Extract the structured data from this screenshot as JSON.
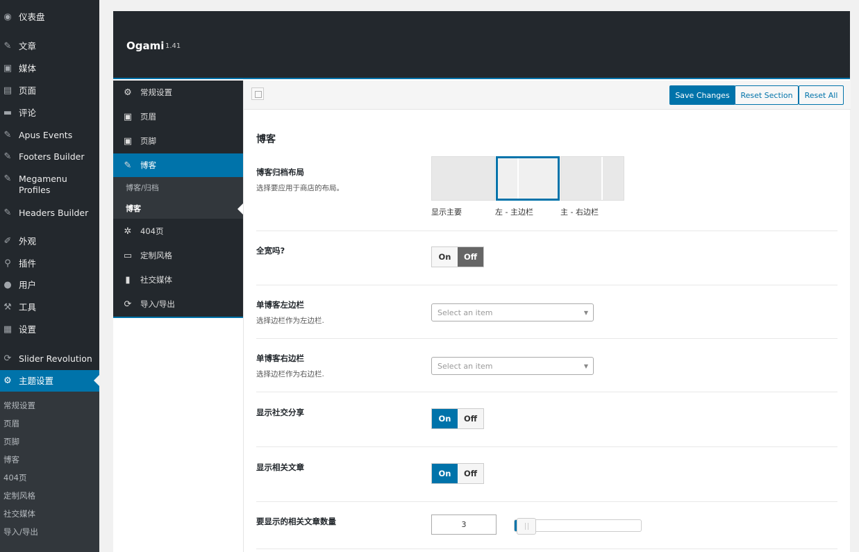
{
  "wp_sidebar": {
    "items": [
      {
        "label": "仪表盘",
        "icon": "dashboard-icon"
      },
      {
        "label": "文章",
        "icon": "pin-icon"
      },
      {
        "label": "媒体",
        "icon": "media-icon"
      },
      {
        "label": "页面",
        "icon": "page-icon"
      },
      {
        "label": "评论",
        "icon": "comment-icon"
      },
      {
        "label": "Apus Events",
        "icon": "pin-icon"
      },
      {
        "label": "Footers Builder",
        "icon": "pin-icon"
      },
      {
        "label": "Megamenu Profiles",
        "icon": "pin-icon"
      },
      {
        "label": "Headers Builder",
        "icon": "pin-icon"
      },
      {
        "label": "外观",
        "icon": "brush-icon"
      },
      {
        "label": "插件",
        "icon": "plugin-icon"
      },
      {
        "label": "用户",
        "icon": "user-icon"
      },
      {
        "label": "工具",
        "icon": "wrench-icon"
      },
      {
        "label": "设置",
        "icon": "settings-icon"
      },
      {
        "label": "Slider Revolution",
        "icon": "slider-icon"
      },
      {
        "label": "主题设置",
        "icon": "gear-icon"
      }
    ],
    "submenu": [
      "常规设置",
      "页眉",
      "页脚",
      "博客",
      "404页",
      "定制风格",
      "社交媒体",
      "导入/导出"
    ]
  },
  "panel": {
    "title": "Ogami",
    "version": "1.41"
  },
  "ogami_nav": {
    "items": [
      {
        "label": "常规设置",
        "icon": "cogs-icon"
      },
      {
        "label": "页眉",
        "icon": "window-icon"
      },
      {
        "label": "页脚",
        "icon": "window-icon"
      },
      {
        "label": "博客",
        "icon": "pencil-icon"
      },
      {
        "label": "404页",
        "icon": "gear-icon"
      },
      {
        "label": "定制风格",
        "icon": "css-icon"
      },
      {
        "label": "社交媒体",
        "icon": "phone-icon"
      },
      {
        "label": "导入/导出",
        "icon": "refresh-icon"
      }
    ],
    "subitems": [
      "博客/归档",
      "博客"
    ]
  },
  "toolbar": {
    "save": "Save Changes",
    "reset_section": "Reset Section",
    "reset_all": "Reset All"
  },
  "section": {
    "title": "博客"
  },
  "fields": {
    "archive_layout": {
      "label": "博客归档布局",
      "desc": "选择要应用于商店的布局。",
      "options": [
        "显示主要",
        "左 - 主边栏",
        "主 - 右边栏"
      ],
      "selected_index": 1
    },
    "full_width": {
      "label": "全宽吗?",
      "on": "On",
      "off": "Off",
      "state": "off"
    },
    "left_sidebar": {
      "label": "单博客左边栏",
      "desc": "选择边栏作为左边栏.",
      "placeholder": "Select an item"
    },
    "right_sidebar": {
      "label": "单博客右边栏",
      "desc": "选择边栏作为右边栏.",
      "placeholder": "Select an item"
    },
    "social_share": {
      "label": "显示社交分享",
      "on": "On",
      "off": "Off",
      "state": "on"
    },
    "related_posts": {
      "label": "显示相关文章",
      "on": "On",
      "off": "Off",
      "state": "on"
    },
    "related_count": {
      "label": "要显示的相关文章数量",
      "value": "3",
      "slider_fraction": 0.02
    }
  },
  "colors": {
    "accent": "#0073aa",
    "admin_dark": "#23282d"
  }
}
